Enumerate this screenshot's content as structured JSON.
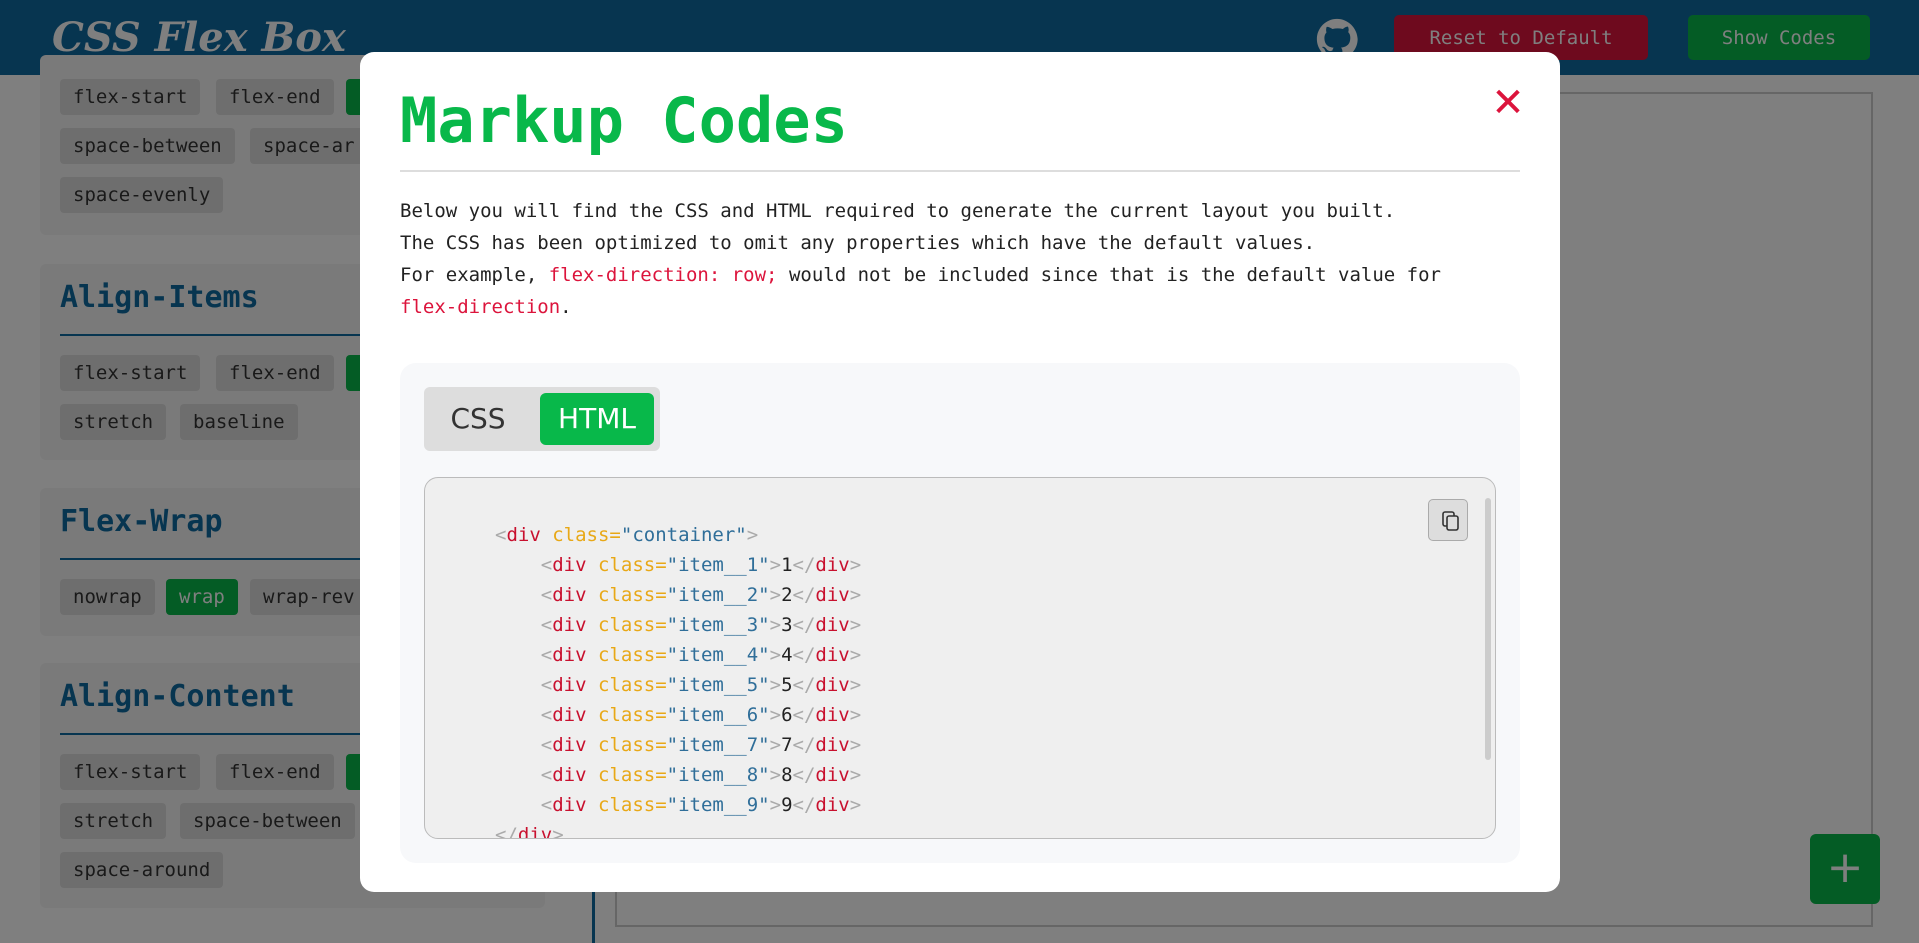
{
  "header": {
    "logo": "CSS Flex Box",
    "reset_label": "Reset to Default",
    "show_codes_label": "Show Codes"
  },
  "sidebar": {
    "justify_content": {
      "options": [
        "flex-start",
        "flex-end",
        "space-between",
        "space-ar",
        "space-evenly"
      ]
    },
    "align_items": {
      "title": "Align-Items",
      "options": [
        "flex-start",
        "flex-end",
        "stretch",
        "baseline"
      ]
    },
    "flex_wrap": {
      "title": "Flex-Wrap",
      "options": [
        "nowrap",
        "wrap",
        "wrap-rev"
      ],
      "selected": "wrap"
    },
    "align_content": {
      "title": "Align-Content",
      "options": [
        "flex-start",
        "flex-end",
        "stretch",
        "space-between",
        "space-around"
      ]
    }
  },
  "fab": {
    "label": "+"
  },
  "modal": {
    "title": "Markup Codes",
    "close_label": "✕",
    "desc_line1": "Below you will find the CSS and HTML required to generate the current layout you built.",
    "desc_line2": "The CSS has been optimized to omit any properties which have the default values.",
    "desc_line3_prefix": "For example, ",
    "desc_line3_code": "flex-direction: row;",
    "desc_line3_middle": " would not be included since that is the default value for",
    "desc_line4_code": "flex-direction",
    "desc_line4_suffix": ".",
    "tabs": {
      "css": "CSS",
      "html": "HTML",
      "active": "HTML"
    },
    "code": {
      "container_class": "container",
      "items": [
        {
          "class": "item__1",
          "text": "1"
        },
        {
          "class": "item__2",
          "text": "2"
        },
        {
          "class": "item__3",
          "text": "3"
        },
        {
          "class": "item__4",
          "text": "4"
        },
        {
          "class": "item__5",
          "text": "5"
        },
        {
          "class": "item__6",
          "text": "6"
        },
        {
          "class": "item__7",
          "text": "7"
        },
        {
          "class": "item__8",
          "text": "8"
        },
        {
          "class": "item__9",
          "text": "9"
        }
      ]
    }
  },
  "colors": {
    "header_bg": "#0f6ba0",
    "accent_green": "#08b84a",
    "accent_red": "#dc143c",
    "code_tag": "#c8102e",
    "code_attr": "#e8a817",
    "code_value": "#2f6e99"
  }
}
